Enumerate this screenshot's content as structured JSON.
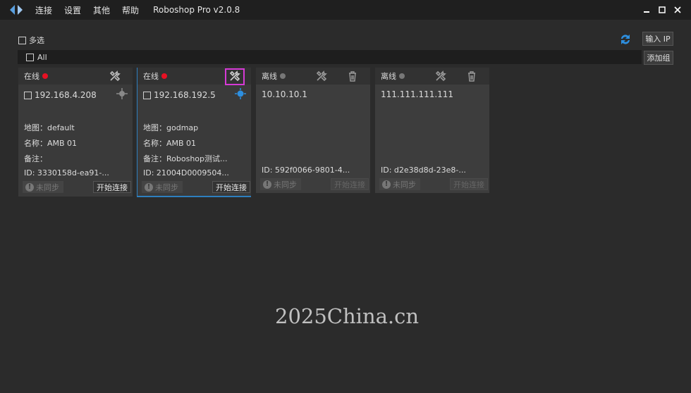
{
  "app": {
    "title": "Roboshop Pro v2.0.8"
  },
  "menu": [
    "连接",
    "设置",
    "其他",
    "帮助"
  ],
  "window_controls": [
    "minimize-icon",
    "maximize-icon",
    "close-icon"
  ],
  "toolbar": {
    "multi_select_label": "多选",
    "input_ip_label": "输入 IP",
    "add_group_label": "添加组",
    "all_label": "All"
  },
  "colors": {
    "online_dot": "#e81123",
    "offline_dot": "#777777",
    "accent": "#2d7fbf",
    "highlight": "#d63ad6"
  },
  "cards": [
    {
      "status": "在线",
      "ip": "192.168.4.208",
      "map": "地图：default",
      "name": "名称：AMB 01",
      "note": "备注：",
      "id": "ID: 3330158d-ea91-...",
      "sync": "未同步",
      "connect": "开始连接"
    },
    {
      "status": "在线",
      "ip": "192.168.192.5",
      "map": "地图：godmap",
      "name": "名称：AMB 01",
      "note": "备注：Roboshop测试...",
      "id": "ID: 21004D0009504...",
      "sync": "未同步",
      "connect": "开始连接"
    },
    {
      "status": "离线",
      "ip": "10.10.10.1",
      "id": "ID: 592f0066-9801-4...",
      "sync": "未同步",
      "connect": "开始连接"
    },
    {
      "status": "离线",
      "ip": "111.111.111.111",
      "id": "ID: d2e38d8d-23e8-...",
      "sync": "未同步",
      "connect": "开始连接"
    }
  ],
  "watermark": "2025China.cn"
}
